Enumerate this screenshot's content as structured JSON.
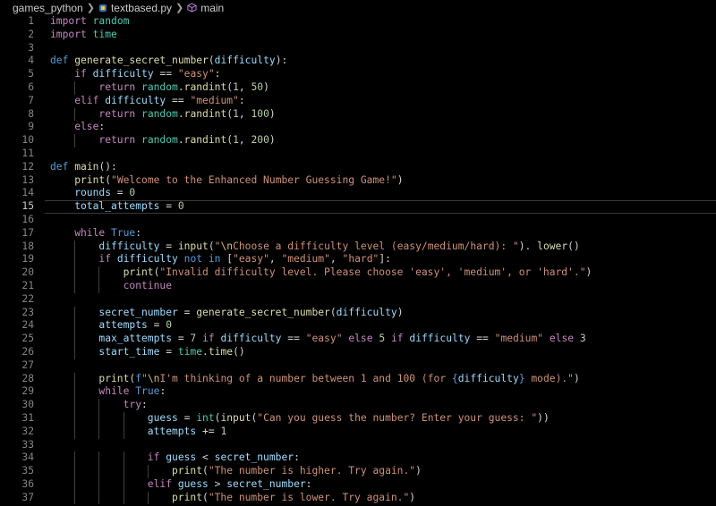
{
  "breadcrumb": {
    "folder": "games_python",
    "file": "textbased.py",
    "symbol": "main"
  },
  "editor": {
    "current_line": 15,
    "lines": [
      {
        "n": "1",
        "ind": 0,
        "t": [
          [
            "kc",
            "import"
          ],
          [
            "o",
            " "
          ],
          [
            "m",
            "random"
          ]
        ]
      },
      {
        "n": "2",
        "ind": 0,
        "t": [
          [
            "kc",
            "import"
          ],
          [
            "o",
            " "
          ],
          [
            "m",
            "time"
          ]
        ]
      },
      {
        "n": "3",
        "ind": 0,
        "t": []
      },
      {
        "n": "4",
        "ind": 0,
        "t": [
          [
            "k",
            "def"
          ],
          [
            "o",
            " "
          ],
          [
            "f",
            "generate_secret_number"
          ],
          [
            "p",
            "("
          ],
          [
            "v",
            "difficulty"
          ],
          [
            "p",
            "):"
          ]
        ]
      },
      {
        "n": "5",
        "ind": 1,
        "t": [
          [
            "kc",
            "if"
          ],
          [
            "o",
            " "
          ],
          [
            "v",
            "difficulty"
          ],
          [
            "o",
            " == "
          ],
          [
            "s",
            "\"easy\""
          ],
          [
            "p",
            ":"
          ]
        ]
      },
      {
        "n": "6",
        "ind": 2,
        "t": [
          [
            "kc",
            "return"
          ],
          [
            "o",
            " "
          ],
          [
            "m",
            "random"
          ],
          [
            "p",
            "."
          ],
          [
            "f",
            "randint"
          ],
          [
            "p",
            "("
          ],
          [
            "n",
            "1"
          ],
          [
            "p",
            ", "
          ],
          [
            "n",
            "50"
          ],
          [
            "p",
            ")"
          ]
        ]
      },
      {
        "n": "7",
        "ind": 1,
        "t": [
          [
            "kc",
            "elif"
          ],
          [
            "o",
            " "
          ],
          [
            "v",
            "difficulty"
          ],
          [
            "o",
            " == "
          ],
          [
            "s",
            "\"medium\""
          ],
          [
            "p",
            ":"
          ]
        ]
      },
      {
        "n": "8",
        "ind": 2,
        "t": [
          [
            "kc",
            "return"
          ],
          [
            "o",
            " "
          ],
          [
            "m",
            "random"
          ],
          [
            "p",
            "."
          ],
          [
            "f",
            "randint"
          ],
          [
            "p",
            "("
          ],
          [
            "n",
            "1"
          ],
          [
            "p",
            ", "
          ],
          [
            "n",
            "100"
          ],
          [
            "p",
            ")"
          ]
        ]
      },
      {
        "n": "9",
        "ind": 1,
        "t": [
          [
            "kc",
            "else"
          ],
          [
            "p",
            ":"
          ]
        ]
      },
      {
        "n": "10",
        "ind": 2,
        "t": [
          [
            "kc",
            "return"
          ],
          [
            "o",
            " "
          ],
          [
            "m",
            "random"
          ],
          [
            "p",
            "."
          ],
          [
            "f",
            "randint"
          ],
          [
            "p",
            "("
          ],
          [
            "n",
            "1"
          ],
          [
            "p",
            ", "
          ],
          [
            "n",
            "200"
          ],
          [
            "p",
            ")"
          ]
        ]
      },
      {
        "n": "11",
        "ind": 0,
        "t": []
      },
      {
        "n": "12",
        "ind": 0,
        "t": [
          [
            "k",
            "def"
          ],
          [
            "o",
            " "
          ],
          [
            "f",
            "main"
          ],
          [
            "p",
            "():"
          ]
        ]
      },
      {
        "n": "13",
        "ind": 1,
        "t": [
          [
            "f",
            "print"
          ],
          [
            "p",
            "("
          ],
          [
            "s",
            "\"Welcome to the Enhanced Number Guessing Game!\""
          ],
          [
            "p",
            ")"
          ]
        ]
      },
      {
        "n": "14",
        "ind": 1,
        "t": [
          [
            "v",
            "rounds"
          ],
          [
            "o",
            " = "
          ],
          [
            "n",
            "0"
          ]
        ]
      },
      {
        "n": "15",
        "ind": 1,
        "t": [
          [
            "v",
            "total_attempts"
          ],
          [
            "o",
            " = "
          ],
          [
            "n",
            "0"
          ]
        ]
      },
      {
        "n": "16",
        "ind": 0,
        "t": []
      },
      {
        "n": "17",
        "ind": 1,
        "t": [
          [
            "kc",
            "while"
          ],
          [
            "o",
            " "
          ],
          [
            "b",
            "True"
          ],
          [
            "p",
            ":"
          ]
        ]
      },
      {
        "n": "18",
        "ind": 2,
        "t": [
          [
            "v",
            "difficulty"
          ],
          [
            "o",
            " = "
          ],
          [
            "f",
            "input"
          ],
          [
            "p",
            "("
          ],
          [
            "s",
            "\""
          ],
          [
            "e",
            "\\n"
          ],
          [
            "s",
            "Choose a difficulty level (easy/medium/hard): \""
          ],
          [
            "p",
            "). "
          ],
          [
            "f",
            "lower"
          ],
          [
            "p",
            "()"
          ]
        ]
      },
      {
        "n": "19",
        "ind": 2,
        "t": [
          [
            "kc",
            "if"
          ],
          [
            "o",
            " "
          ],
          [
            "v",
            "difficulty"
          ],
          [
            "o",
            " "
          ],
          [
            "k",
            "not in"
          ],
          [
            "o",
            " ["
          ],
          [
            "s",
            "\"easy\""
          ],
          [
            "p",
            ", "
          ],
          [
            "s",
            "\"medium\""
          ],
          [
            "p",
            ", "
          ],
          [
            "s",
            "\"hard\""
          ],
          [
            "p",
            "]:"
          ]
        ]
      },
      {
        "n": "20",
        "ind": 3,
        "t": [
          [
            "f",
            "print"
          ],
          [
            "p",
            "("
          ],
          [
            "s",
            "\"Invalid difficulty level. Please choose 'easy', 'medium', or 'hard'.\""
          ],
          [
            "p",
            ")"
          ]
        ]
      },
      {
        "n": "21",
        "ind": 3,
        "t": [
          [
            "kc",
            "continue"
          ]
        ]
      },
      {
        "n": "22",
        "ind": 0,
        "t": []
      },
      {
        "n": "23",
        "ind": 2,
        "t": [
          [
            "v",
            "secret_number"
          ],
          [
            "o",
            " = "
          ],
          [
            "f",
            "generate_secret_number"
          ],
          [
            "p",
            "("
          ],
          [
            "v",
            "difficulty"
          ],
          [
            "p",
            ")"
          ]
        ]
      },
      {
        "n": "24",
        "ind": 2,
        "t": [
          [
            "v",
            "attempts"
          ],
          [
            "o",
            " = "
          ],
          [
            "n",
            "0"
          ]
        ]
      },
      {
        "n": "25",
        "ind": 2,
        "t": [
          [
            "v",
            "max_attempts"
          ],
          [
            "o",
            " = "
          ],
          [
            "n",
            "7"
          ],
          [
            "o",
            " "
          ],
          [
            "kc",
            "if"
          ],
          [
            "o",
            " "
          ],
          [
            "v",
            "difficulty"
          ],
          [
            "o",
            " == "
          ],
          [
            "s",
            "\"easy\""
          ],
          [
            "o",
            " "
          ],
          [
            "kc",
            "else"
          ],
          [
            "o",
            " "
          ],
          [
            "n",
            "5"
          ],
          [
            "o",
            " "
          ],
          [
            "kc",
            "if"
          ],
          [
            "o",
            " "
          ],
          [
            "v",
            "difficulty"
          ],
          [
            "o",
            " == "
          ],
          [
            "s",
            "\"medium\""
          ],
          [
            "o",
            " "
          ],
          [
            "kc",
            "else"
          ],
          [
            "o",
            " "
          ],
          [
            "n",
            "3"
          ]
        ]
      },
      {
        "n": "26",
        "ind": 2,
        "t": [
          [
            "v",
            "start_time"
          ],
          [
            "o",
            " = "
          ],
          [
            "m",
            "time"
          ],
          [
            "p",
            "."
          ],
          [
            "f",
            "time"
          ],
          [
            "p",
            "()"
          ]
        ]
      },
      {
        "n": "27",
        "ind": 0,
        "t": []
      },
      {
        "n": "28",
        "ind": 2,
        "t": [
          [
            "f",
            "print"
          ],
          [
            "p",
            "("
          ],
          [
            "k",
            "f"
          ],
          [
            "s",
            "\""
          ],
          [
            "e",
            "\\n"
          ],
          [
            "s",
            "I'm thinking of a number between 1 and 100 (for "
          ],
          [
            "k",
            "{"
          ],
          [
            "v",
            "difficulty"
          ],
          [
            "k",
            "}"
          ],
          [
            "s",
            " mode).\""
          ],
          [
            "p",
            ")"
          ]
        ]
      },
      {
        "n": "29",
        "ind": 2,
        "t": [
          [
            "kc",
            "while"
          ],
          [
            "o",
            " "
          ],
          [
            "b",
            "True"
          ],
          [
            "p",
            ":"
          ]
        ]
      },
      {
        "n": "30",
        "ind": 3,
        "t": [
          [
            "kc",
            "try"
          ],
          [
            "p",
            ":"
          ]
        ]
      },
      {
        "n": "31",
        "ind": 4,
        "t": [
          [
            "v",
            "guess"
          ],
          [
            "o",
            " = "
          ],
          [
            "m",
            "int"
          ],
          [
            "p",
            "("
          ],
          [
            "f",
            "input"
          ],
          [
            "p",
            "("
          ],
          [
            "s",
            "\"Can you guess the number? Enter your guess: \""
          ],
          [
            "p",
            "))"
          ]
        ]
      },
      {
        "n": "32",
        "ind": 4,
        "t": [
          [
            "v",
            "attempts"
          ],
          [
            "o",
            " += "
          ],
          [
            "n",
            "1"
          ]
        ]
      },
      {
        "n": "33",
        "ind": 0,
        "t": []
      },
      {
        "n": "34",
        "ind": 4,
        "t": [
          [
            "kc",
            "if"
          ],
          [
            "o",
            " "
          ],
          [
            "v",
            "guess"
          ],
          [
            "o",
            " < "
          ],
          [
            "v",
            "secret_number"
          ],
          [
            "p",
            ":"
          ]
        ]
      },
      {
        "n": "35",
        "ind": 5,
        "t": [
          [
            "f",
            "print"
          ],
          [
            "p",
            "("
          ],
          [
            "s",
            "\"The number is higher. Try again.\""
          ],
          [
            "p",
            ")"
          ]
        ]
      },
      {
        "n": "36",
        "ind": 4,
        "t": [
          [
            "kc",
            "elif"
          ],
          [
            "o",
            " "
          ],
          [
            "v",
            "guess"
          ],
          [
            "o",
            " > "
          ],
          [
            "v",
            "secret_number"
          ],
          [
            "p",
            ":"
          ]
        ]
      },
      {
        "n": "37",
        "ind": 5,
        "t": [
          [
            "f",
            "print"
          ],
          [
            "p",
            "("
          ],
          [
            "s",
            "\"The number is lower. Try again.\""
          ],
          [
            "p",
            ")"
          ]
        ]
      }
    ]
  }
}
